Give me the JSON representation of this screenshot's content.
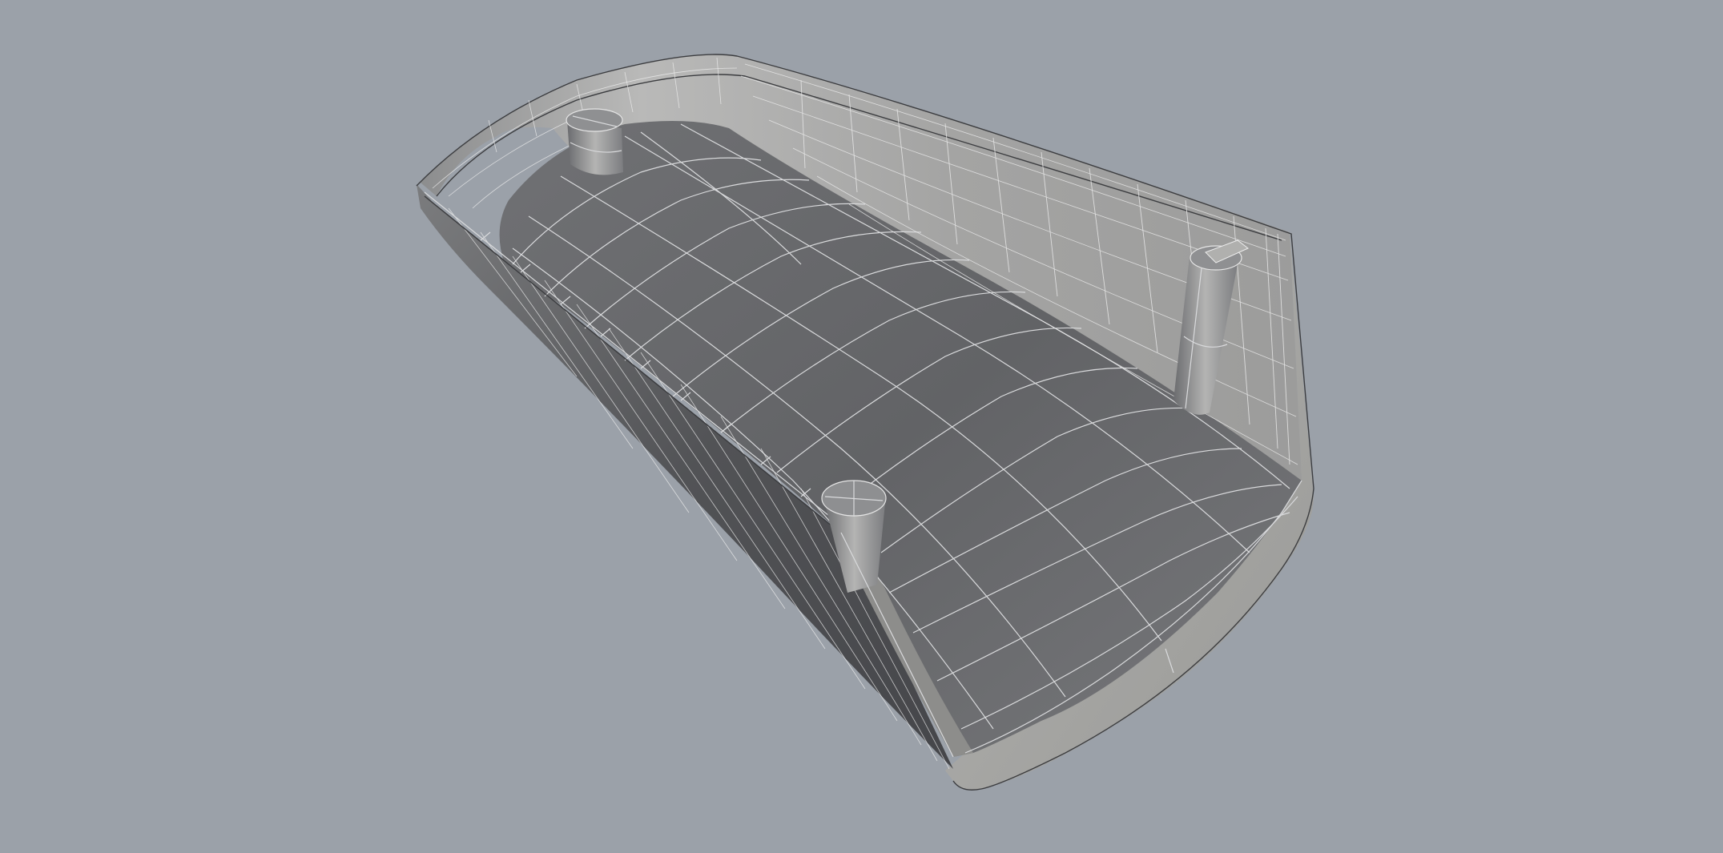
{
  "viewport": {
    "background_color": "#9ba1a9",
    "display_mode": "shaded-with-wireframe",
    "model": {
      "description_icon": "3d-shell-model-icon",
      "parts": [
        "shell-outer-wall",
        "shell-inner-floor",
        "shell-rim",
        "boss-left",
        "boss-right",
        "boss-front"
      ],
      "colors": {
        "floor": "#6a6b6e",
        "wall_light": "#c4c4c2",
        "wall_dark": "#59595c",
        "rim": "#a6a6a3",
        "wire": "#dadbdd"
      }
    }
  }
}
